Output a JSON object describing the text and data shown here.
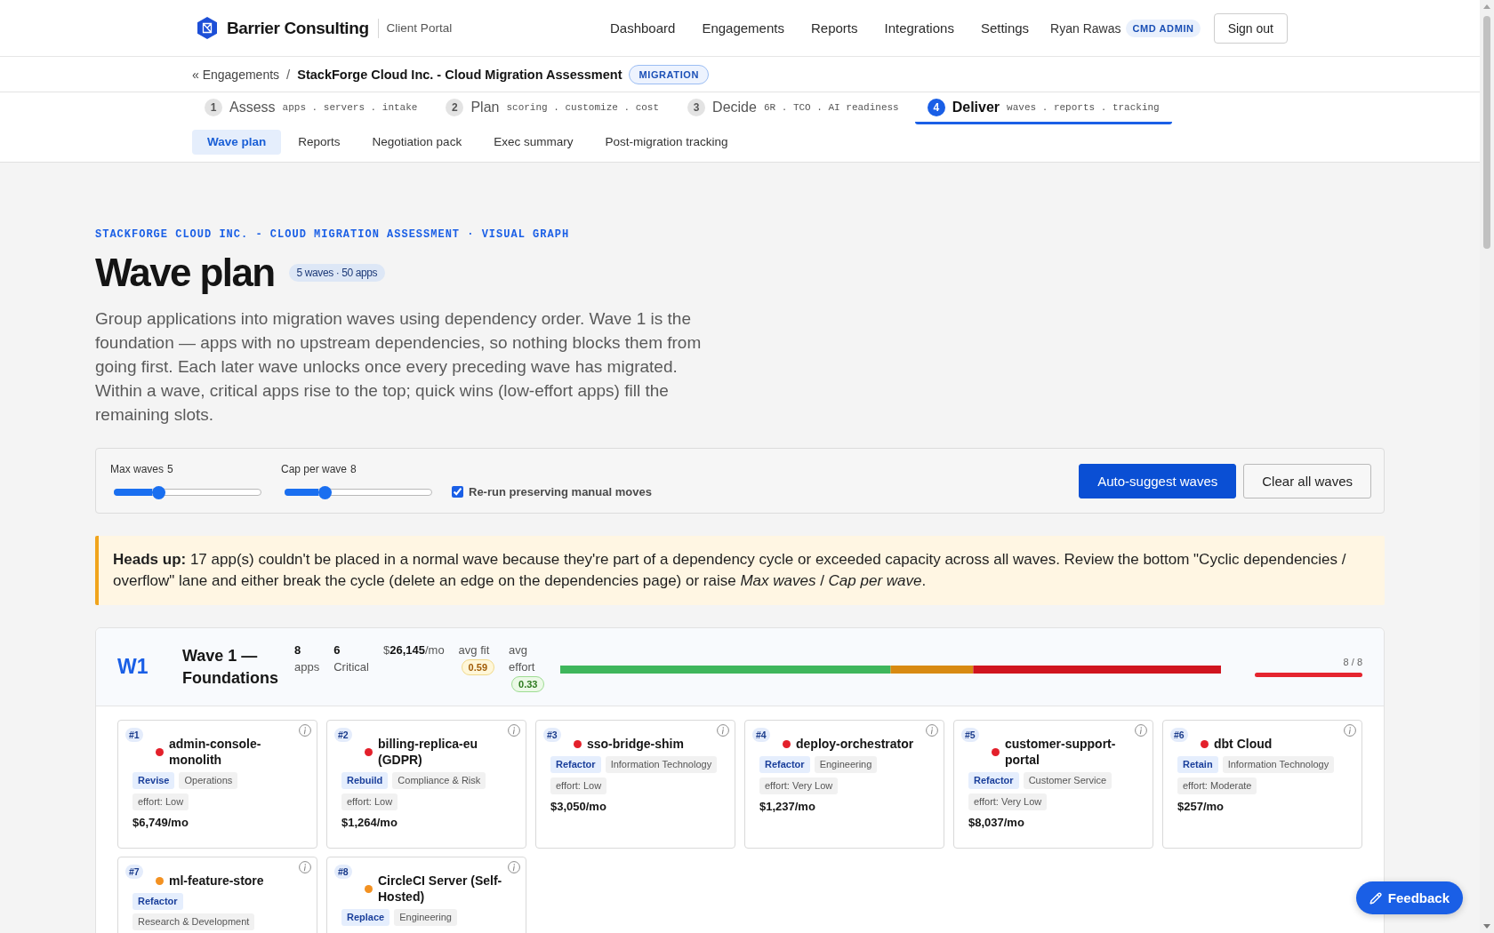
{
  "header": {
    "brand": "Barrier Consulting",
    "portal": "Client Portal",
    "nav": [
      {
        "label": "Dashboard"
      },
      {
        "label": "Engagements"
      },
      {
        "label": "Reports"
      },
      {
        "label": "Integrations"
      },
      {
        "label": "Settings"
      }
    ],
    "user": {
      "name": "Ryan Rawas",
      "role": "CMD ADMIN"
    },
    "sign_out": "Sign out"
  },
  "breadcrumb": {
    "back": "« Engagements",
    "separator": "/",
    "title": "StackForge Cloud Inc. - Cloud Migration Assessment",
    "badge": "MIGRATION"
  },
  "steps": [
    {
      "number": "1",
      "title": "Assess",
      "hint": "apps . servers . intake",
      "selected": false
    },
    {
      "number": "2",
      "title": "Plan",
      "hint": "scoring . customize . cost",
      "selected": false
    },
    {
      "number": "3",
      "title": "Decide",
      "hint": "6R . TCO . AI readiness",
      "selected": false
    },
    {
      "number": "4",
      "title": "Deliver",
      "hint": "waves . reports . tracking",
      "selected": true
    }
  ],
  "subtabs": [
    {
      "label": "Wave plan",
      "selected": true
    },
    {
      "label": "Reports",
      "selected": false
    },
    {
      "label": "Negotiation pack",
      "selected": false
    },
    {
      "label": "Exec summary",
      "selected": false
    },
    {
      "label": "Post-migration tracking",
      "selected": false
    }
  ],
  "page": {
    "eyebrow": "STACKFORGE CLOUD INC. - CLOUD MIGRATION ASSESSMENT · VISUAL GRAPH",
    "title": "Wave plan",
    "badge": "5 waves · 50 apps",
    "intro": "Group applications into migration waves using dependency order. Wave 1 is the foundation — apps with no upstream dependencies, so nothing blocks them from going first. Each later wave unlocks once every preceding wave has migrated. Within a wave, critical apps rise to the top; quick wins (low-effort apps) fill the remaining slots."
  },
  "controls": {
    "sliders": [
      {
        "label": "Max waves",
        "reading": "5",
        "level": 0.3
      },
      {
        "label": "Cap per wave",
        "reading": "8",
        "level": 0.27
      }
    ],
    "checkbox": {
      "label": "Re-run preserving manual moves",
      "checked": true
    },
    "buttons": [
      {
        "label": "Auto-suggest waves",
        "kind": "primary"
      },
      {
        "label": "Clear all waves",
        "kind": "secondary"
      }
    ]
  },
  "notice": {
    "text": "**Heads up:** 17 app(s) couldn't be placed in a normal wave because they're part of a dependency cycle or exceeded capacity across all waves. Review the bottom \"Cyclic dependencies / overflow\" lane and either break the cycle (delete an edge on the dependencies page) or raise *Max waves* / *Cap per wave*."
  },
  "waves": [
    {
      "code": "W1",
      "title": "Wave 1 — Foundations",
      "stats": [
        {
          "value": "8",
          "label": "apps"
        },
        {
          "value": "6",
          "label": "Critical"
        }
      ],
      "cost": "$**26,145**/mo",
      "metrics": [
        {
          "kind": "fit",
          "label": "avg fit",
          "value": "0.59"
        },
        {
          "kind": "effort",
          "label": "avg effort",
          "value": "0.33"
        }
      ],
      "capacity": {
        "reading": "8 / 8",
        "level": 1
      },
      "apps": [
        {
          "rank": "#1",
          "name": "admin-console-monolith",
          "color": "#e3202b",
          "strategy": "Revise",
          "department": "Operations",
          "effort": "effort: Low",
          "cost": "$6,749/mo"
        },
        {
          "rank": "#2",
          "name": "billing-replica-eu (GDPR)",
          "color": "#e3202b",
          "strategy": "Rebuild",
          "department": "Compliance & Risk",
          "effort": "effort: Low",
          "cost": "$1,264/mo"
        },
        {
          "rank": "#3",
          "name": "sso-bridge-shim",
          "color": "#e3202b",
          "strategy": "Refactor",
          "department": "Information Technology",
          "effort": "effort: Low",
          "cost": "$3,050/mo"
        },
        {
          "rank": "#4",
          "name": "deploy-orchestrator",
          "color": "#e3202b",
          "strategy": "Refactor",
          "department": "Engineering",
          "effort": "effort: Very Low",
          "cost": "$1,237/mo"
        },
        {
          "rank": "#5",
          "name": "customer-support-portal",
          "color": "#e3202b",
          "strategy": "Refactor",
          "department": "Customer Service",
          "effort": "effort: Very Low",
          "cost": "$8,037/mo"
        },
        {
          "rank": "#6",
          "name": "dbt Cloud",
          "color": "#e3202b",
          "strategy": "Retain",
          "department": "Information Technology",
          "effort": "effort: Moderate",
          "cost": "$257/mo"
        },
        {
          "rank": "#7",
          "name": "ml-feature-store",
          "color": "#f39121",
          "strategy": "Refactor",
          "department": "Research & Development"
        },
        {
          "rank": "#8",
          "name": "CircleCI Server (Self-Hosted)",
          "color": "#f39121",
          "strategy": "Replace",
          "department": "Engineering"
        }
      ]
    }
  ],
  "feedback": "Feedback"
}
